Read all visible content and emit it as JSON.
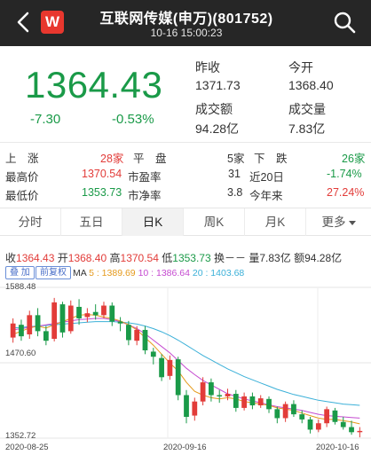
{
  "header": {
    "title": "互联网传媒(申万)(801752)",
    "subtitle": "10-16 15:00:23",
    "logo_letter": "W"
  },
  "quote": {
    "price": "1364.43",
    "change": "-7.30",
    "change_pct": "-0.53%",
    "prev_close_label": "昨收",
    "prev_close": "1371.73",
    "open_label": "今开",
    "open": "1368.40",
    "turnover_label": "成交额",
    "turnover": "94.28亿",
    "volume_label": "成交量",
    "volume": "7.83亿"
  },
  "breadth": {
    "up_label": "上　涨",
    "up_value": "28家",
    "flat_label": "平　盘",
    "flat_value": "5家",
    "down_label": "下　跌",
    "down_value": "26家",
    "high_label": "最高价",
    "high_value": "1370.54",
    "pe_label": "市盈率",
    "pe_value": "31",
    "d20_label": "近20日",
    "d20_value": "-1.74%",
    "low_label": "最低价",
    "low_value": "1353.73",
    "pb_label": "市净率",
    "pb_value": "3.8",
    "ytd_label": "今年来",
    "ytd_value": "27.24%"
  },
  "tabs": [
    "分时",
    "五日",
    "日K",
    "周K",
    "月K",
    "更多"
  ],
  "active_tab": "日K",
  "chart_info": {
    "close_label": "收",
    "close": "1364.43",
    "open_label": "开",
    "open": "1368.40",
    "high_label": "高",
    "high": "1370.54",
    "low_label": "低",
    "low": "1353.73",
    "turnover_rate": "换－－",
    "volume_label": "量",
    "volume": "7.83亿",
    "amount_label": "额",
    "amount": "94.28亿",
    "btn_overlay": "叠 加",
    "btn_adjust": "前复权",
    "ma_label": "MA",
    "ma5": "5 : 1389.69",
    "ma10": "10 : 1386.64",
    "ma20": "20 : 1403.68"
  },
  "chart_labels": {
    "y_top": "1588.48",
    "y_mid": "1470.60",
    "y_bottom": "1352.72",
    "x_left": "2020-08-25",
    "x_mid": "2020-09-16",
    "x_right": "2020-10-16"
  },
  "colors": {
    "up": "#e23c39",
    "down": "#1a9a48",
    "ma5": "#e59a1c",
    "ma10": "#c54bd0",
    "ma20": "#3bb0d8",
    "header_bg": "#262626",
    "logo": "#e8372e"
  },
  "chart_data": {
    "type": "candlestick",
    "ylim": [
      1352.72,
      1588.48
    ],
    "x_ticks": [
      "2020-08-25",
      "2020-09-16",
      "2020-10-16"
    ],
    "candles": [
      {
        "o": 1510,
        "c": 1532,
        "h": 1540,
        "l": 1502
      },
      {
        "o": 1530,
        "c": 1512,
        "h": 1538,
        "l": 1505
      },
      {
        "o": 1515,
        "c": 1545,
        "h": 1552,
        "l": 1508
      },
      {
        "o": 1545,
        "c": 1520,
        "h": 1556,
        "l": 1512
      },
      {
        "o": 1520,
        "c": 1505,
        "h": 1528,
        "l": 1498
      },
      {
        "o": 1508,
        "c": 1565,
        "h": 1572,
        "l": 1504
      },
      {
        "o": 1562,
        "c": 1518,
        "h": 1566,
        "l": 1510
      },
      {
        "o": 1520,
        "c": 1560,
        "h": 1568,
        "l": 1516
      },
      {
        "o": 1558,
        "c": 1540,
        "h": 1570,
        "l": 1530
      },
      {
        "o": 1542,
        "c": 1548,
        "h": 1556,
        "l": 1534
      },
      {
        "o": 1550,
        "c": 1545,
        "h": 1562,
        "l": 1538
      },
      {
        "o": 1545,
        "c": 1560,
        "h": 1566,
        "l": 1540
      },
      {
        "o": 1560,
        "c": 1535,
        "h": 1565,
        "l": 1528
      },
      {
        "o": 1535,
        "c": 1532,
        "h": 1542,
        "l": 1520
      },
      {
        "o": 1530,
        "c": 1506,
        "h": 1536,
        "l": 1498
      },
      {
        "o": 1505,
        "c": 1522,
        "h": 1528,
        "l": 1498
      },
      {
        "o": 1522,
        "c": 1490,
        "h": 1528,
        "l": 1484
      },
      {
        "o": 1488,
        "c": 1480,
        "h": 1494,
        "l": 1468
      },
      {
        "o": 1478,
        "c": 1448,
        "h": 1484,
        "l": 1442
      },
      {
        "o": 1450,
        "c": 1475,
        "h": 1482,
        "l": 1444
      },
      {
        "o": 1476,
        "c": 1420,
        "h": 1480,
        "l": 1412
      },
      {
        "o": 1420,
        "c": 1386,
        "h": 1428,
        "l": 1376
      },
      {
        "o": 1388,
        "c": 1410,
        "h": 1416,
        "l": 1380
      },
      {
        "o": 1410,
        "c": 1440,
        "h": 1448,
        "l": 1404
      },
      {
        "o": 1440,
        "c": 1420,
        "h": 1446,
        "l": 1410
      },
      {
        "o": 1420,
        "c": 1418,
        "h": 1428,
        "l": 1408
      },
      {
        "o": 1418,
        "c": 1422,
        "h": 1430,
        "l": 1412
      },
      {
        "o": 1422,
        "c": 1400,
        "h": 1428,
        "l": 1394
      },
      {
        "o": 1400,
        "c": 1418,
        "h": 1424,
        "l": 1396
      },
      {
        "o": 1418,
        "c": 1404,
        "h": 1424,
        "l": 1398
      },
      {
        "o": 1404,
        "c": 1415,
        "h": 1420,
        "l": 1400
      },
      {
        "o": 1414,
        "c": 1398,
        "h": 1418,
        "l": 1392
      },
      {
        "o": 1398,
        "c": 1384,
        "h": 1402,
        "l": 1376
      },
      {
        "o": 1384,
        "c": 1406,
        "h": 1410,
        "l": 1378
      },
      {
        "o": 1406,
        "c": 1390,
        "h": 1412,
        "l": 1386
      },
      {
        "o": 1390,
        "c": 1382,
        "h": 1396,
        "l": 1376
      },
      {
        "o": 1382,
        "c": 1366,
        "h": 1386,
        "l": 1360
      },
      {
        "o": 1366,
        "c": 1376,
        "h": 1382,
        "l": 1362
      },
      {
        "o": 1376,
        "c": 1398,
        "h": 1402,
        "l": 1370
      },
      {
        "o": 1396,
        "c": 1378,
        "h": 1400,
        "l": 1374
      },
      {
        "o": 1378,
        "c": 1370,
        "h": 1386,
        "l": 1366
      },
      {
        "o": 1370,
        "c": 1362,
        "h": 1380,
        "l": 1358
      },
      {
        "o": 1362,
        "c": 1364,
        "h": 1370,
        "l": 1354
      }
    ],
    "ma5": [
      1515,
      1520,
      1525,
      1528,
      1525,
      1530,
      1535,
      1540,
      1545,
      1546,
      1545,
      1542,
      1540,
      1536,
      1530,
      1522,
      1510,
      1498,
      1484,
      1470,
      1458,
      1440,
      1426,
      1420,
      1416,
      1414,
      1416,
      1414,
      1410,
      1408,
      1406,
      1404,
      1400,
      1398,
      1396,
      1392,
      1388,
      1384,
      1382,
      1382,
      1380,
      1378,
      1375
    ],
    "ma10": [
      1522,
      1524,
      1526,
      1528,
      1530,
      1532,
      1534,
      1536,
      1538,
      1539,
      1540,
      1540,
      1538,
      1535,
      1530,
      1524,
      1516,
      1506,
      1496,
      1486,
      1474,
      1462,
      1452,
      1443,
      1436,
      1429,
      1422,
      1418,
      1414,
      1411,
      1408,
      1405,
      1402,
      1400,
      1398,
      1396,
      1393,
      1390,
      1388,
      1387,
      1386,
      1385,
      1384
    ],
    "ma20": [
      1525,
      1526,
      1527,
      1528,
      1529,
      1530,
      1531,
      1532,
      1533,
      1534,
      1535,
      1535,
      1535,
      1534,
      1533,
      1531,
      1528,
      1524,
      1519,
      1513,
      1506,
      1498,
      1490,
      1482,
      1475,
      1468,
      1461,
      1455,
      1449,
      1444,
      1439,
      1434,
      1429,
      1425,
      1421,
      1418,
      1415,
      1412,
      1410,
      1408,
      1406,
      1405,
      1404
    ]
  }
}
